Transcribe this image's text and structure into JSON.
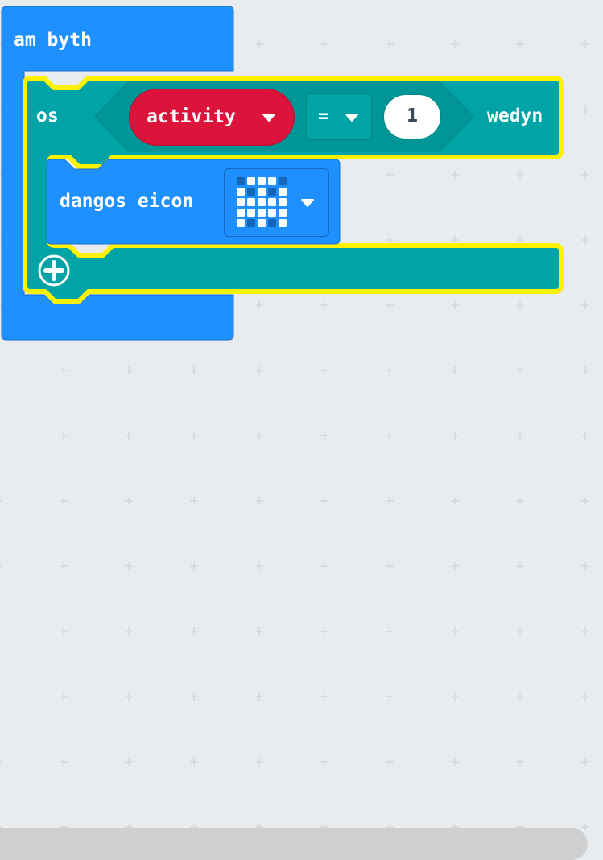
{
  "forever_block": {
    "label": "am byth"
  },
  "if_block": {
    "if_label": "os",
    "then_label": "wedyn",
    "add_else_icon": "plus-circle-icon"
  },
  "condition": {
    "variable": "activity",
    "operator": "=",
    "value": "1"
  },
  "show_icon_block": {
    "label": "dangos eicon",
    "icon_pattern": [
      [
        0,
        1,
        1,
        1,
        0
      ],
      [
        1,
        0,
        1,
        0,
        1
      ],
      [
        1,
        1,
        1,
        1,
        1
      ],
      [
        1,
        1,
        1,
        1,
        1
      ],
      [
        1,
        0,
        1,
        0,
        1
      ]
    ]
  },
  "colors": {
    "workspace": "#e8ecee",
    "grid_cross": "#d2d8dc",
    "loops_blue": "#1e90ff",
    "logic_teal": "#00a4a6",
    "variable_red": "#dc143c",
    "highlight_yellow": "#fff200",
    "led_on": "#ffffff",
    "led_off": "#1365b8",
    "scrollbar": "#cfcfcf"
  }
}
